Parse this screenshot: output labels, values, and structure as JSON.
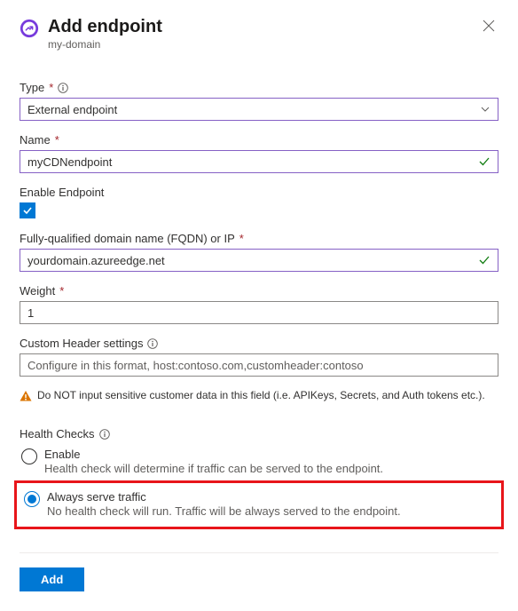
{
  "header": {
    "title": "Add endpoint",
    "subtitle": "my-domain"
  },
  "type": {
    "label": "Type",
    "value": "External endpoint"
  },
  "name": {
    "label": "Name",
    "value": "myCDNendpoint"
  },
  "enable": {
    "label": "Enable Endpoint",
    "checked": true
  },
  "fqdn": {
    "label": "Fully-qualified domain name (FQDN) or IP",
    "value": "yourdomain.azureedge.net"
  },
  "weight": {
    "label": "Weight",
    "value": "1"
  },
  "customHeader": {
    "label": "Custom Header settings",
    "placeholder": "Configure in this format, host:contoso.com,customheader:contoso"
  },
  "warning": "Do NOT input sensitive customer data in this field (i.e. APIKeys, Secrets, and Auth tokens etc.).",
  "healthChecks": {
    "label": "Health Checks",
    "options": [
      {
        "label": "Enable",
        "desc": "Health check will determine if traffic can be served to the endpoint.",
        "selected": false
      },
      {
        "label": "Always serve traffic",
        "desc": "No health check will run. Traffic will be always served to the endpoint.",
        "selected": true
      }
    ]
  },
  "footer": {
    "add": "Add"
  }
}
